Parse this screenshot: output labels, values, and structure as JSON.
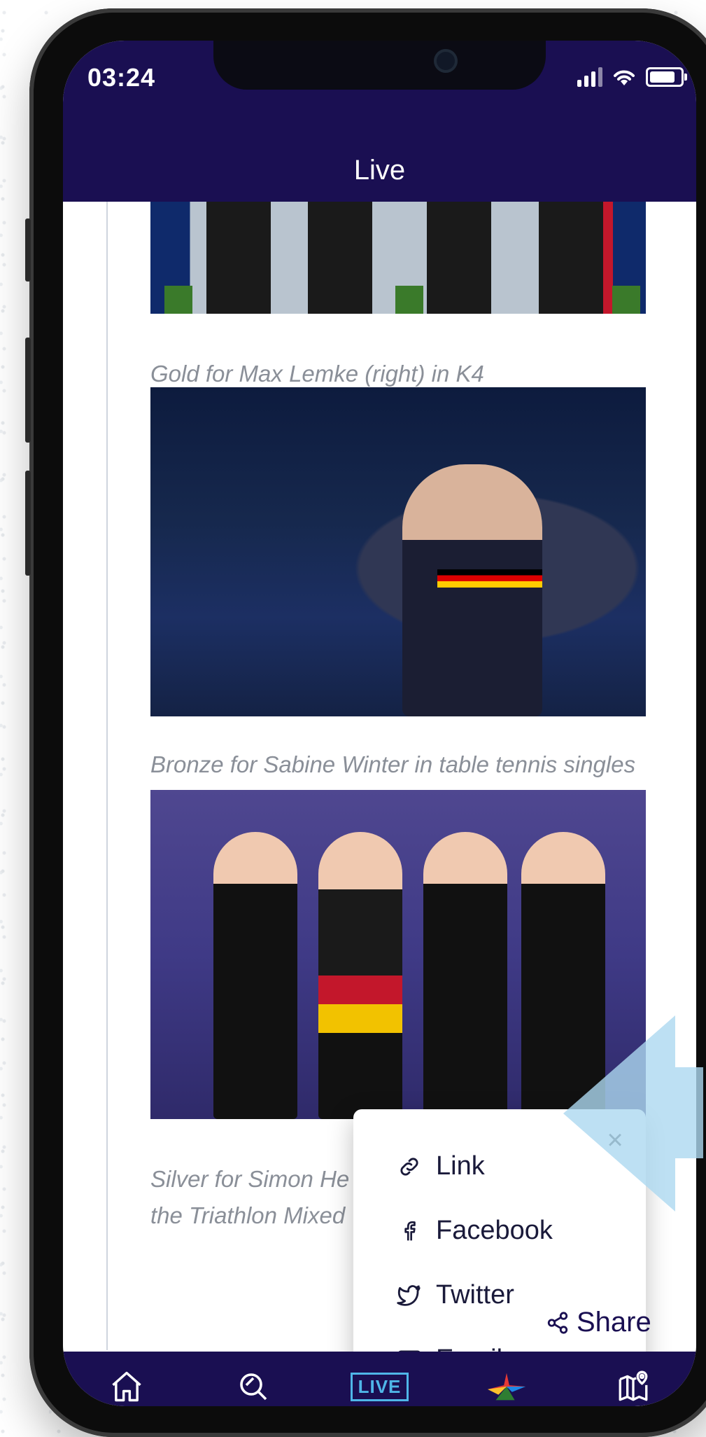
{
  "status_bar": {
    "time": "03:24"
  },
  "header": {
    "title": "Live"
  },
  "feed": {
    "items": [
      {
        "caption": "Gold for Max Lemke (right) in K4"
      },
      {
        "caption": "Bronze for Sabine Winter in table tennis singles"
      },
      {
        "caption_line1": "Silver for Simon He",
        "caption_line2": "the Triathlon Mixed"
      }
    ]
  },
  "share_popup": {
    "items": [
      {
        "label": "Link",
        "icon": "link-icon"
      },
      {
        "label": "Facebook",
        "icon": "facebook-icon"
      },
      {
        "label": "Twitter",
        "icon": "twitter-icon"
      },
      {
        "label": "Email",
        "icon": "email-icon"
      }
    ],
    "close_icon": "close-icon"
  },
  "share_button": {
    "label": "Share",
    "icon": "share-icon"
  },
  "bottom_nav": {
    "items": [
      {
        "name": "home",
        "icon": "home-icon"
      },
      {
        "name": "search",
        "icon": "search-icon"
      },
      {
        "name": "live",
        "label": "LIVE"
      },
      {
        "name": "games",
        "icon": "games-star-logo-icon"
      },
      {
        "name": "map",
        "icon": "map-pin-icon"
      }
    ]
  },
  "colors": {
    "brand_navy": "#1a0f52",
    "accent_blue": "#4fb6e8",
    "caption_gray": "#8a8f98"
  }
}
